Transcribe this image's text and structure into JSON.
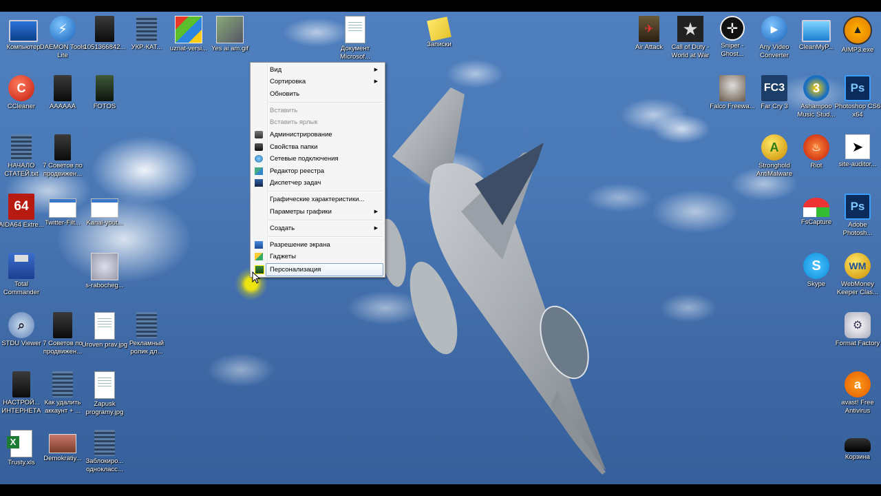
{
  "desktop_icons": [
    {
      "label": "Компьютер",
      "icon": "computer-icon"
    },
    {
      "label": "DAEMON Tools Lite",
      "icon": "daemon-tools-icon"
    },
    {
      "label": "1051366842...",
      "icon": "file-icon"
    },
    {
      "label": "УКР-КАТ...",
      "icon": "archive-icon"
    },
    {
      "label": "uznat-versi...",
      "icon": "windows-image-icon"
    },
    {
      "label": "Yes ai am.gif",
      "icon": "dog-image-icon"
    },
    {
      "label": "Документ Microsof...",
      "icon": "word-document-icon"
    },
    {
      "label": "Записки",
      "icon": "sticky-notes-icon"
    },
    {
      "label": "Air Attack",
      "icon": "air-attack-icon"
    },
    {
      "label": "Call of Duty - World at War",
      "icon": "call-of-duty-icon"
    },
    {
      "label": "Sniper - Ghost...",
      "icon": "sniper-icon"
    },
    {
      "label": "Any Video Converter",
      "icon": "video-converter-icon"
    },
    {
      "label": "CleanMyP...",
      "icon": "cleanmypc-icon"
    },
    {
      "label": "AIMP3.exe",
      "icon": "aimp-icon"
    },
    {
      "label": "CCleaner",
      "icon": "ccleaner-icon"
    },
    {
      "label": "AAAAAA",
      "icon": "folder-icon"
    },
    {
      "label": "FOTOS",
      "icon": "folder-icon"
    },
    {
      "label": "Falco Freewa...",
      "icon": "falcon-icon"
    },
    {
      "label": "Far Cry 3",
      "icon": "far-cry-icon"
    },
    {
      "label": "Ashampoo Music Stud...",
      "icon": "ashampoo-icon"
    },
    {
      "label": "Photoshop CS6 x64",
      "icon": "photoshop-icon"
    },
    {
      "label": "НАЧАЛО СТАТЕЙ.txt",
      "icon": "archive-icon"
    },
    {
      "label": "7 Советов по продвижен...",
      "icon": "book-icon"
    },
    {
      "label": "Stronghold AntiMalware",
      "icon": "stronghold-icon"
    },
    {
      "label": "Riot",
      "icon": "riot-icon"
    },
    {
      "label": "site-auditor...",
      "icon": "cursor-icon"
    },
    {
      "label": "AIDA64 Extre...",
      "icon": "aida64-icon"
    },
    {
      "label": "Twitter-Filt...",
      "icon": "screenshot-icon"
    },
    {
      "label": "Kanal-yout...",
      "icon": "screenshot-icon"
    },
    {
      "label": "FsCapture",
      "icon": "fscapture-icon"
    },
    {
      "label": "Adobe Photosh...",
      "icon": "photoshop-icon"
    },
    {
      "label": "Total Commander",
      "icon": "floppy-icon"
    },
    {
      "label": "s-rabocheg...",
      "icon": "image-icon"
    },
    {
      "label": "Skype",
      "icon": "skype-icon"
    },
    {
      "label": "WebMoney Keeper Clas...",
      "icon": "webmoney-icon"
    },
    {
      "label": "STDU Viewer",
      "icon": "stdu-viewer-icon"
    },
    {
      "label": "7 Советов по продвижен...",
      "icon": "book-icon"
    },
    {
      "label": "Uroven prav.jpg",
      "icon": "document-icon"
    },
    {
      "label": "Рекламный ролик дл...",
      "icon": "archive-icon"
    },
    {
      "label": "Format Factory",
      "icon": "format-factory-icon"
    },
    {
      "label": "НАСТРОЙ... ИНТЕРНЕТА",
      "icon": "book-icon"
    },
    {
      "label": "Как удалить аккаунт + ...",
      "icon": "archive-icon"
    },
    {
      "label": "Zapusk programy.jpg",
      "icon": "document-icon"
    },
    {
      "label": "avast! Free Antivirus",
      "icon": "avast-icon"
    },
    {
      "label": "Trusty.xls",
      "icon": "excel-icon"
    },
    {
      "label": "Demokratiy...",
      "icon": "image-icon"
    },
    {
      "label": "Заблокиро... однокласс...",
      "icon": "archive-icon"
    },
    {
      "label": "Корзина",
      "icon": "recycle-bin-icon"
    }
  ],
  "context_menu": {
    "items": [
      {
        "label": "Вид",
        "submenu": true
      },
      {
        "label": "Сортировка",
        "submenu": true
      },
      {
        "label": "Обновить"
      },
      {
        "label": "Вставить",
        "disabled": true
      },
      {
        "label": "Вставить ярлык",
        "disabled": true
      },
      {
        "label": "Администрирование",
        "icon": "admin-tools-icon"
      },
      {
        "label": "Свойства папки",
        "icon": "folder-options-icon"
      },
      {
        "label": "Сетевые подключения",
        "icon": "network-icon"
      },
      {
        "label": "Редактор реестра",
        "icon": "registry-icon"
      },
      {
        "label": "Диспетчер задач",
        "icon": "task-manager-icon"
      },
      {
        "label": "Графические характеристики..."
      },
      {
        "label": "Параметры графики",
        "submenu": true
      },
      {
        "label": "Создать",
        "submenu": true
      },
      {
        "label": "Разрешение экрана",
        "icon": "display-icon"
      },
      {
        "label": "Гаджеты",
        "icon": "gadgets-icon"
      },
      {
        "label": "Персонализация",
        "icon": "personalization-icon",
        "highlighted": true
      }
    ]
  },
  "colors": {
    "menu_highlight_border": "#7da2ce",
    "cursor_halo": "#ffee00"
  }
}
